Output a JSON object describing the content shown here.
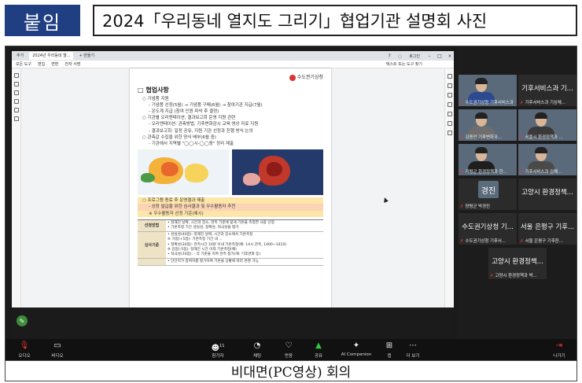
{
  "header": {
    "tag": "붙임",
    "title": "2024「우리동네 열지도 그리기」협업기관 설명회 사진"
  },
  "caption": "비대면(PC영상) 회의",
  "screen": {
    "tabs": [
      "추가",
      "2024년 우리동네 열...",
      "+ 만들기"
    ],
    "window_label": "로그인",
    "menu": [
      "모든 도구",
      "편집",
      "변환",
      "전자 서명"
    ],
    "search_hint": "텍스트 또는 도구 찾기",
    "document": {
      "org": "수도권기상청",
      "section": "□ 협업사항",
      "lines": [
        {
          "cls": "i1",
          "text": "○ 기념품 지원"
        },
        {
          "cls": "i2",
          "text": "- 기념품 선정(5월) → 기념품 구매(6월) → 참여기관 지급(7월)"
        },
        {
          "cls": "i2",
          "text": "- 온도계 지급 (참여 인원 파악 후 결정)"
        },
        {
          "cls": "i1",
          "text": "○ 기관별 오리엔테이션, 결과보고회 운영 지원 관련"
        },
        {
          "cls": "i2",
          "text": "- 오리엔테이션: 관측방법, 기후변화감시 교육 영상 자료 지원"
        },
        {
          "cls": "i2",
          "text": "- 결과보고회: 일정 공유, 지원 기관 선정과 진행 방식 논의"
        },
        {
          "cls": "i1",
          "text": "○ 관측값 수집을 위한 양식 배부(6월 중)"
        },
        {
          "cls": "i2",
          "text": "- 기관에서 지역별 \"◯◯시-◯◯동\" 정리 제출"
        }
      ],
      "after_map": [
        {
          "cls": "i1",
          "text": "○ 프로그램 종료 후 운영결과 제출",
          "hl": "hl"
        },
        {
          "cls": "i2",
          "text": "- 상장 발급을 위한 심사결과 및 우수활동자 추천",
          "hl": "hl2"
        },
        {
          "cls": "i2",
          "text": "※ 우수활동자 선정 기준(예시)",
          "hl": "hl"
        }
      ],
      "table": [
        {
          "head": "선정방법",
          "lines": [
            "• 정해진 날짜, 시간과 장소, 관측 기준에 맞게 기온을 측정한 사람 선정",
            "• 기온측정 기간 성실성, 정확성, 적극성을 평가"
          ]
        },
        {
          "head": "심사기준",
          "lines": [
            "• 성실성(40점): 정해진 날짜, 시간과 장소에서 기온측정",
            "※ 가점(+5점): 기온측정 기간 내 ...",
            "• 정확성(30점): 관측시간 10분 이내 기온측정(예: 14시 관측, 1400~1410)",
            "※ 감점(-5점): 정해진 시간 이외 기온측정(예)",
            "• 적극성(30점): - 각 기준을 지켜 관측 참가(예: 기후변화 등)"
          ]
        },
        {
          "head": "",
          "lines": [
            "• 단단지가 참여자를 평가하여 기온을 상황에 따라 변경 가능"
          ]
        }
      ]
    }
  },
  "participants": [
    {
      "name": "수도권기상청 기후서비스과 이...",
      "type": "video",
      "shirt": "#2b4a8f"
    },
    {
      "name": "기후서비스과 기...",
      "big": true,
      "sub": "기후서비스과 기상체..."
    },
    {
      "name": "김종안 기후변화과...",
      "type": "video",
      "shirt": "#6e6e6e"
    },
    {
      "name": "서울시 환경정책과 ...",
      "type": "video",
      "shirt": "#3a3a3a"
    },
    {
      "name": "가평군 환경정책과 한...",
      "type": "video",
      "shirt": "#1e1e1e"
    },
    {
      "name": "기후서비스과 김해...",
      "type": "video",
      "shirt": "#4a4a4a"
    },
    {
      "name": "양평군 박경진",
      "avatar": "경진"
    },
    {
      "name": "고양시 환경정책...",
      "big": true,
      "sub": ""
    },
    {
      "name": "수도권기상청 기...",
      "big": true,
      "sub": "수도권기상청 기후서..."
    },
    {
      "name": "서울 은평구 기후...",
      "big": true,
      "sub": "서울 은평구 기후환..."
    },
    {
      "name": "고양시 환경정책...",
      "big": true,
      "sub": "고양시 환경정책과 박..."
    }
  ],
  "toolbar": {
    "mic": "오디오",
    "video": "비디오",
    "participants": "참가자",
    "participant_count": "11",
    "chat": "채팅",
    "react": "반응",
    "share": "공유",
    "companion": "AI Companion",
    "apps": "앱",
    "more": "더 보기",
    "leave": "나가기"
  }
}
